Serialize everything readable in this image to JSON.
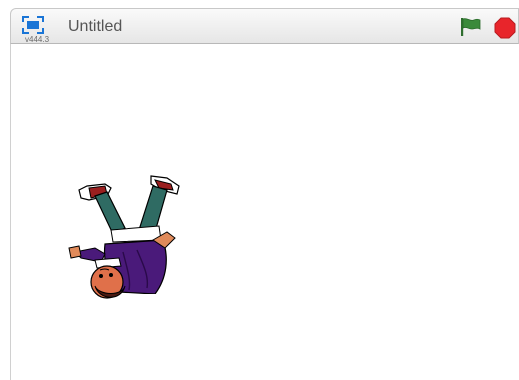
{
  "header": {
    "project_title": "Untitled",
    "version": "v444.3",
    "fullscreen_icon": "fullscreen-icon",
    "flag_icon": "green-flag-icon",
    "stop_icon": "stop-sign-icon"
  },
  "stage": {
    "sprite": "upside-down-person-sprite"
  },
  "colors": {
    "accent_blue": "#1a75d6",
    "flag_green": "#3a8a3a",
    "stop_red": "#e8252b"
  }
}
